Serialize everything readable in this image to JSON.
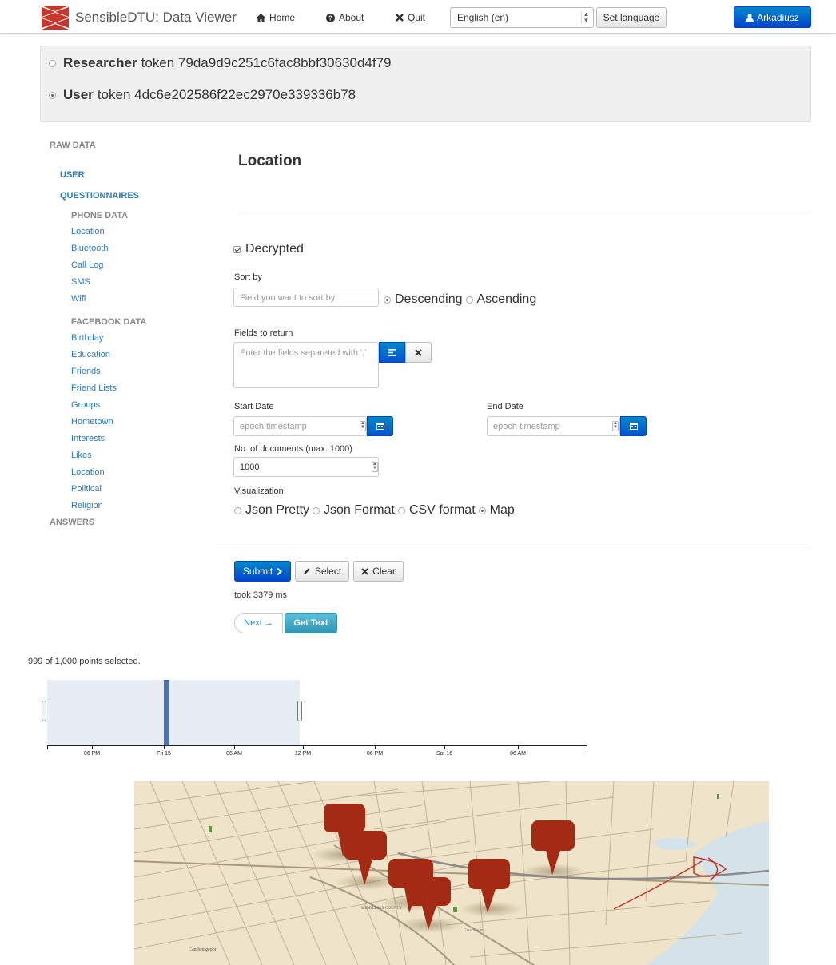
{
  "navbar": {
    "brand": "SensibleDTU: Data Viewer",
    "links": [
      {
        "label": "Home",
        "icon": "home-icon"
      },
      {
        "label": "About",
        "icon": "question-circle-icon"
      },
      {
        "label": "Quit",
        "icon": "close-icon"
      }
    ],
    "language_selected": "English (en)",
    "set_language_label": "Set language",
    "user_label": "Arkadiusz",
    "accent_color": "#0055cc"
  },
  "tokens": [
    {
      "role": "Researcher",
      "text": "token 79da9d9c251c6fac8bbf30630d4f79",
      "selected": false
    },
    {
      "role": "User",
      "text": "token 4dc6e202586f22ec2970e339336b78",
      "selected": true
    }
  ],
  "sidebar": {
    "raw_data": "RAW DATA",
    "user": "USER",
    "questionnaires": "QUESTIONNAIRES",
    "phone_data": "PHONE DATA",
    "phone_items": [
      "Location",
      "Bluetooth",
      "Call Log",
      "SMS",
      "Wifi"
    ],
    "facebook_data": "FACEBOOK DATA",
    "facebook_items": [
      "Birthday",
      "Education",
      "Friends",
      "Friend Lists",
      "Groups",
      "Hometown",
      "Interests",
      "Likes",
      "Location",
      "Political",
      "Religion"
    ],
    "answers": "ANSWERS"
  },
  "form": {
    "title": "Location",
    "decrypted_label": "Decrypted",
    "sort_by_label": "Sort by",
    "sort_placeholder": "Field you want to sort by",
    "descending_label": "Descending",
    "ascending_label": "Ascending",
    "fields_label": "Fields to return",
    "fields_placeholder": "Enter the fields separeted with ','",
    "start_date_label": "Start Date",
    "end_date_label": "End Date",
    "date_placeholder": "epoch timestamp",
    "num_docs_label": "No. of documents (max. 1000)",
    "num_docs_value": "1000",
    "visualization_label": "Visualization",
    "viz_options": [
      "Json Pretty",
      "Json Format",
      "CSV format",
      "Map"
    ],
    "viz_selected": "Map",
    "submit_label": "Submit",
    "select_label": "Select",
    "clear_label": "Clear",
    "took": "took 3379 ms",
    "next_label": "Next →",
    "get_text_label": "Get Text"
  },
  "timeline": {
    "selection_text": "999 of 1,000 points selected.",
    "tick_labels": [
      "06 PM",
      "Fri 15",
      "06 AM",
      "12 PM",
      "06 PM",
      "Sat 16",
      "06 AM"
    ]
  },
  "map": {
    "labels": [
      "MIDDLESEX COUNTY",
      "Great Court",
      "Cambridgeport"
    ],
    "marker_color": "#a52a14"
  }
}
